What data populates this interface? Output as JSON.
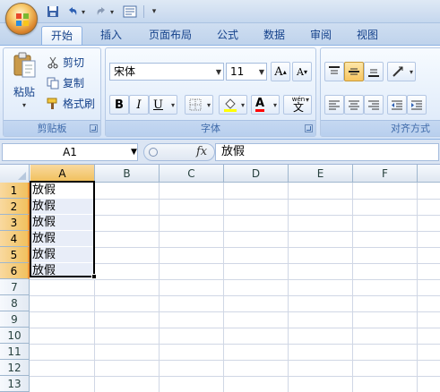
{
  "quick_access": {
    "save_icon": "save-icon",
    "undo_icon": "undo-icon",
    "redo_icon": "redo-icon",
    "print_icon": "print-preview-icon",
    "customize_label": "▾"
  },
  "tabs": [
    {
      "label": "开始"
    },
    {
      "label": "插入"
    },
    {
      "label": "页面布局"
    },
    {
      "label": "公式"
    },
    {
      "label": "数据"
    },
    {
      "label": "审阅"
    },
    {
      "label": "视图"
    }
  ],
  "clipboard": {
    "paste_label": "粘贴",
    "cut_label": "剪切",
    "copy_label": "复制",
    "format_painter_label": "格式刷",
    "group_label": "剪贴板"
  },
  "font": {
    "font_name": "宋体",
    "font_size": "11",
    "grow_label": "A",
    "shrink_label": "A",
    "bold_label": "B",
    "italic_label": "I",
    "underline_label": "U",
    "phonetic_top": "wén",
    "phonetic_char": "文",
    "font_color_label": "A",
    "group_label": "字体",
    "highlight_color": "#ffff00",
    "font_color": "#ff0000"
  },
  "alignment": {
    "group_label": "对齐方式"
  },
  "formula_bar": {
    "name_box": "A1",
    "fx_label": "fx",
    "content": "放假"
  },
  "sheet": {
    "columns": [
      "A",
      "B",
      "C",
      "D",
      "E",
      "F"
    ],
    "rows": [
      "1",
      "2",
      "3",
      "4",
      "5",
      "6",
      "7",
      "8",
      "9",
      "10",
      "11",
      "12",
      "13"
    ],
    "cells_A": [
      "放假",
      "放假",
      "放假",
      "放假",
      "放假",
      "放假"
    ],
    "selected_range": "A1:A6"
  }
}
